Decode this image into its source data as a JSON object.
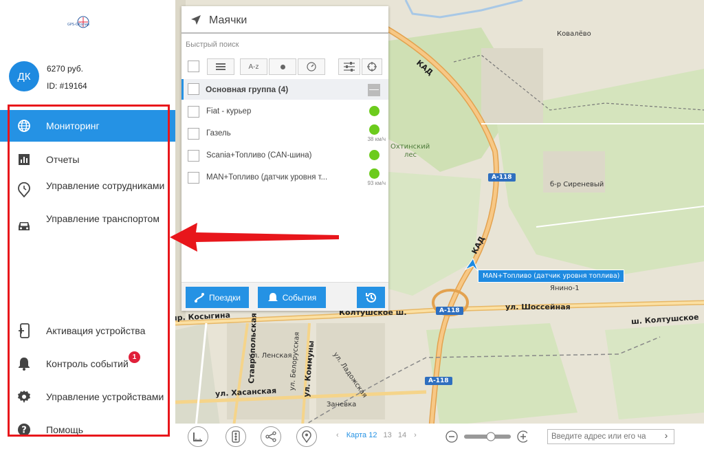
{
  "sidebar": {
    "logo_text": "GPS-ОКопир",
    "avatar_initials": "ДК",
    "balance": "6270 руб.",
    "user_id": "ID: #19164",
    "nav": [
      {
        "label": "Мониторинг",
        "icon": "globe-icon",
        "active": true
      },
      {
        "label": "Отчеты",
        "icon": "bar-chart-icon"
      },
      {
        "label": "Управление сотрудниками",
        "icon": "pin-clock-icon"
      },
      {
        "label": "Управление транспортом",
        "icon": "car-icon"
      }
    ],
    "bottom_nav": [
      {
        "label": "Активация устройства",
        "icon": "device-add-icon"
      },
      {
        "label": "Контроль событий",
        "icon": "bell-icon",
        "badge": "1"
      },
      {
        "label": "Управление устройствами",
        "icon": "gear-icon"
      },
      {
        "label": "Помощь",
        "icon": "help-icon"
      }
    ]
  },
  "panel": {
    "title": "Маячки",
    "search_placeholder": "Быстрый поиск",
    "sort_az": "A-z",
    "group": {
      "label": "Основная группа (4)",
      "toggle": "—"
    },
    "vehicles": [
      {
        "name": "Fiat - курьер",
        "speed": ""
      },
      {
        "name": "Газель",
        "speed": "38 км/ч"
      },
      {
        "name": "Scania+Топливо (CAN-шина)",
        "speed": ""
      },
      {
        "name": "MAN+Топливо (датчик уровня т...",
        "speed": "93 км/ч"
      }
    ],
    "trips_button": "Поездки",
    "events_button": "События"
  },
  "map": {
    "vehicle_label": "MAN+Топливо (датчик уровня топлива)",
    "labels": {
      "kovalevo": "Ковалёво",
      "kad1": "КАД",
      "kad2": "КАД",
      "okhta1": "Охтинский",
      "okhta2": "лес",
      "a118_1": "А-118",
      "a118_2": "А-118",
      "a118_3": "А-118",
      "siren": "б-р Сиреневый",
      "yanino": "Янино-1",
      "shosseynaya": "ул. Шоссейная",
      "koltush1": "Колтушское ш.",
      "koltush2": "ш. Колтушское",
      "kosygina": "пр. Косыгина",
      "stavropol": "Ставропольская",
      "lenskaya": "ул. Ленская",
      "belorus": "ул. Белорусская",
      "kommuny": "ул. Коммуны",
      "ladozh": "ул. Ладожская",
      "khasan": "ул. Хасанская",
      "zanevka": "Заневка"
    }
  },
  "bottombar": {
    "map_prefix": "Карта",
    "maps": [
      "12",
      "13",
      "14"
    ],
    "address_placeholder": "Введите адрес или его ча"
  }
}
